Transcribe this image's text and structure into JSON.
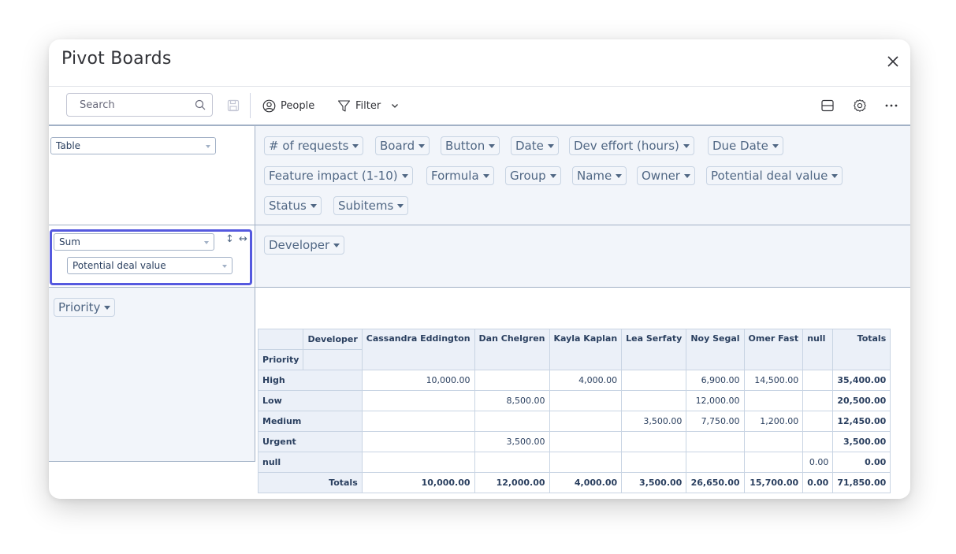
{
  "window": {
    "title": "Pivot Boards"
  },
  "toolbar": {
    "search_placeholder": "Search",
    "people_label": "People",
    "filter_label": "Filter"
  },
  "pivot": {
    "renderer": "Table",
    "aggregator": "Sum",
    "aggregator_field": "Potential deal value",
    "unused_attributes": [
      "# of requests",
      "Board",
      "Button",
      "Date",
      "Dev effort (hours)",
      "Due Date",
      "Feature impact (1-10)",
      "Formula",
      "Group",
      "Name",
      "Owner",
      "Potential deal value",
      "Status",
      "Subitems"
    ],
    "col_attribute": "Developer",
    "row_attribute": "Priority"
  },
  "table": {
    "col_header_label": "Developer",
    "row_header_label": "Priority",
    "columns": [
      "Cassandra Eddington",
      "Dan Chelgren",
      "Kayla Kaplan",
      "Lea Serfaty",
      "Noy Segal",
      "Omer Fast",
      "null"
    ],
    "totals_label": "Totals",
    "rows": [
      {
        "label": "High",
        "cells": [
          "10,000.00",
          "",
          "4,000.00",
          "",
          "6,900.00",
          "14,500.00",
          ""
        ],
        "total": "35,400.00"
      },
      {
        "label": "Low",
        "cells": [
          "",
          "8,500.00",
          "",
          "",
          "12,000.00",
          "",
          ""
        ],
        "total": "20,500.00"
      },
      {
        "label": "Medium",
        "cells": [
          "",
          "",
          "",
          "3,500.00",
          "7,750.00",
          "1,200.00",
          ""
        ],
        "total": "12,450.00"
      },
      {
        "label": "Urgent",
        "cells": [
          "",
          "3,500.00",
          "",
          "",
          "",
          "",
          ""
        ],
        "total": "3,500.00"
      },
      {
        "label": "null",
        "cells": [
          "",
          "",
          "",
          "",
          "",
          "",
          "0.00"
        ],
        "total": "0.00"
      }
    ],
    "col_totals": [
      "10,000.00",
      "12,000.00",
      "4,000.00",
      "3,500.00",
      "26,650.00",
      "15,700.00",
      "0.00"
    ],
    "grand_total": "71,850.00"
  },
  "icons": {
    "search": "search-icon",
    "save": "save-icon",
    "people": "person-circle-icon",
    "filter": "filter-icon",
    "chevron": "chevron-down-icon",
    "layout": "layout-icon",
    "settings": "gear-icon",
    "more": "more-horizontal-icon",
    "close": "close-icon"
  },
  "colors": {
    "accent_focus": "#5559df",
    "pivot_border": "#a2b1c6",
    "pivot_fill": "#f2f5fa"
  }
}
